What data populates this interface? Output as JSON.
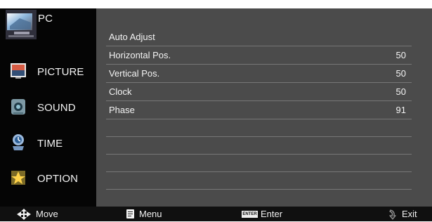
{
  "sidebar": {
    "items": [
      {
        "label": "PC",
        "icon": "computer-icon"
      },
      {
        "label": "PICTURE",
        "icon": "picture-icon"
      },
      {
        "label": "SOUND",
        "icon": "sound-icon"
      },
      {
        "label": "TIME",
        "icon": "clock-icon"
      },
      {
        "label": "OPTION",
        "icon": "star-option-icon"
      }
    ]
  },
  "pc_menu": {
    "rows": [
      {
        "label": "Auto Adjust",
        "value": ""
      },
      {
        "label": "Horizontal Pos.",
        "value": "50"
      },
      {
        "label": "Vertical Pos.",
        "value": "50"
      },
      {
        "label": "Clock",
        "value": "50"
      },
      {
        "label": "Phase",
        "value": "91"
      }
    ]
  },
  "footer": {
    "move": "Move",
    "menu": "Menu",
    "enter_key": "ENTER",
    "enter": "Enter",
    "exit": "Exit"
  },
  "colors": {
    "sidebar_background": "#050505",
    "panel_background": "#4b4b4b",
    "footer_background": "#101010",
    "text": "#f4f4f4"
  }
}
